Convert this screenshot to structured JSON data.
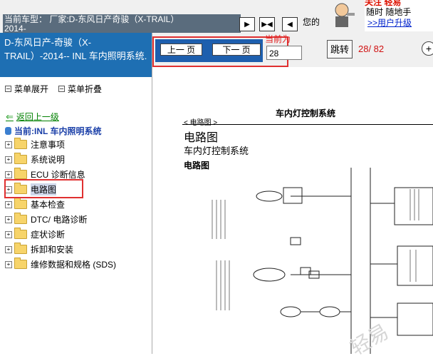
{
  "header": {
    "vehicle_label": "当前车型：  厂家:D-东风日产奇骏（X-TRAIL）",
    "vehicle_year": "2014-",
    "notice": "您的",
    "ad_line1": "关注 轻易",
    "ad_line2": "随时 随地手",
    "ad_line3": ">>用户升级"
  },
  "sidebar": {
    "title": "D-东风日产-奇骏（X-TRAIL）-2014-- INL 车内照明系统.",
    "expand_label": "菜单展开",
    "collapse_label": "菜单折叠",
    "back_label": "返回上一级",
    "current_label": "当前:INL 车内照明系统",
    "items": [
      {
        "label": "注意事项"
      },
      {
        "label": "系统说明"
      },
      {
        "label": "ECU 诊断信息"
      },
      {
        "label": "电路图"
      },
      {
        "label": "基本检查"
      },
      {
        "label": "DTC/ 电路诊断"
      },
      {
        "label": "症状诊断"
      },
      {
        "label": "拆卸和安装"
      },
      {
        "label": "维修数据和规格 (SDS)"
      }
    ]
  },
  "toolbar": {
    "prev_label": "上一 页",
    "next_label": "下一 页",
    "current_label": "当前为",
    "page_value": "28",
    "jump_label": "跳转",
    "page_count": "28/ 82"
  },
  "document": {
    "header": "车内灯控制系统",
    "section_tag": "< 电路图 >",
    "section_title": "电路图",
    "subtitle": "车内灯控制系统",
    "subtitle2": "电路图",
    "watermark": "轻易"
  }
}
